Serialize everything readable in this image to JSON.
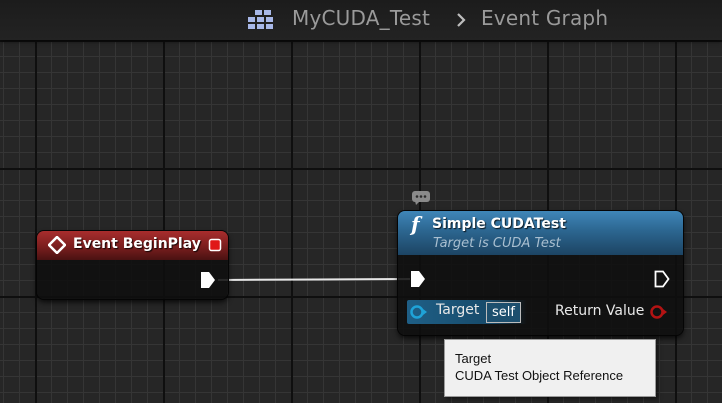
{
  "breadcrumb": {
    "blueprint_name": "MyCUDA_Test",
    "graph_name": "Event Graph"
  },
  "event_node": {
    "title": "Event BeginPlay",
    "header_color": "#8b2222"
  },
  "function_node": {
    "title": "Simple CUDATest",
    "subtitle": "Target is CUDA Test",
    "header_color": "#2c6690",
    "input_pin_label": "Target",
    "input_pin_default": "self",
    "output_pin_label": "Return Value"
  },
  "tooltip": {
    "title": "Target",
    "description": "CUDA Test Object Reference"
  },
  "colors": {
    "canvas": "#262626",
    "object_pin": "#1fa3d8",
    "return_pin": "#b31313",
    "exec_wire": "#e6e6e6"
  }
}
